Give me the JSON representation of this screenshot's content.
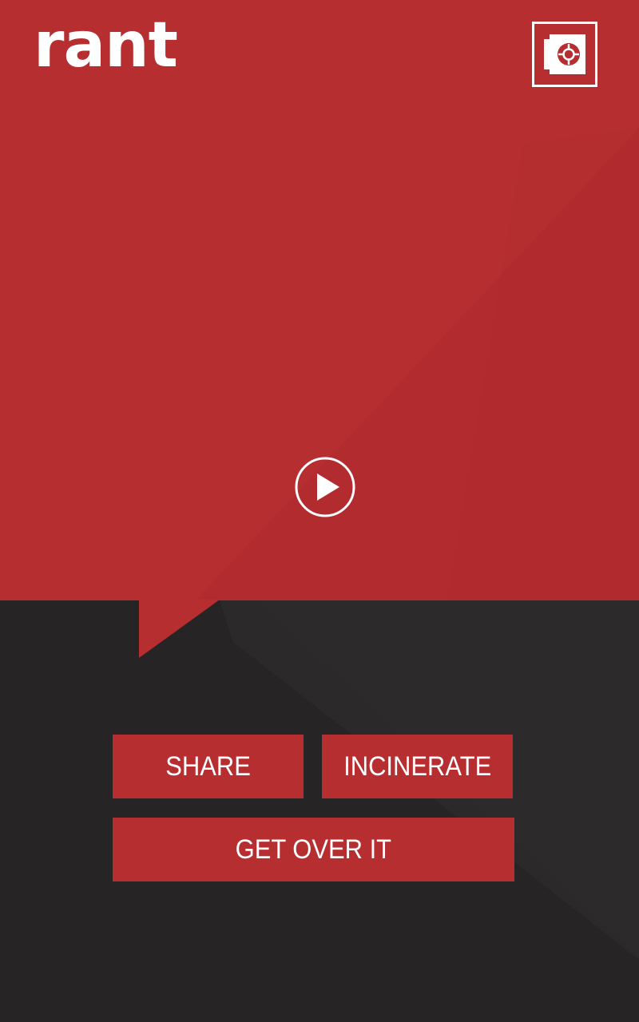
{
  "app": {
    "logo_text": "rant"
  },
  "header": {
    "vault_icon": "vault-icon"
  },
  "player": {
    "play_icon": "play-icon"
  },
  "actions": {
    "share_label": "SHARE",
    "incinerate_label": "INCINERATE",
    "get_over_it_label": "GET OVER IT"
  },
  "colors": {
    "primary_red": "#b72e31",
    "dark_background": "#272425",
    "white": "#ffffff"
  }
}
